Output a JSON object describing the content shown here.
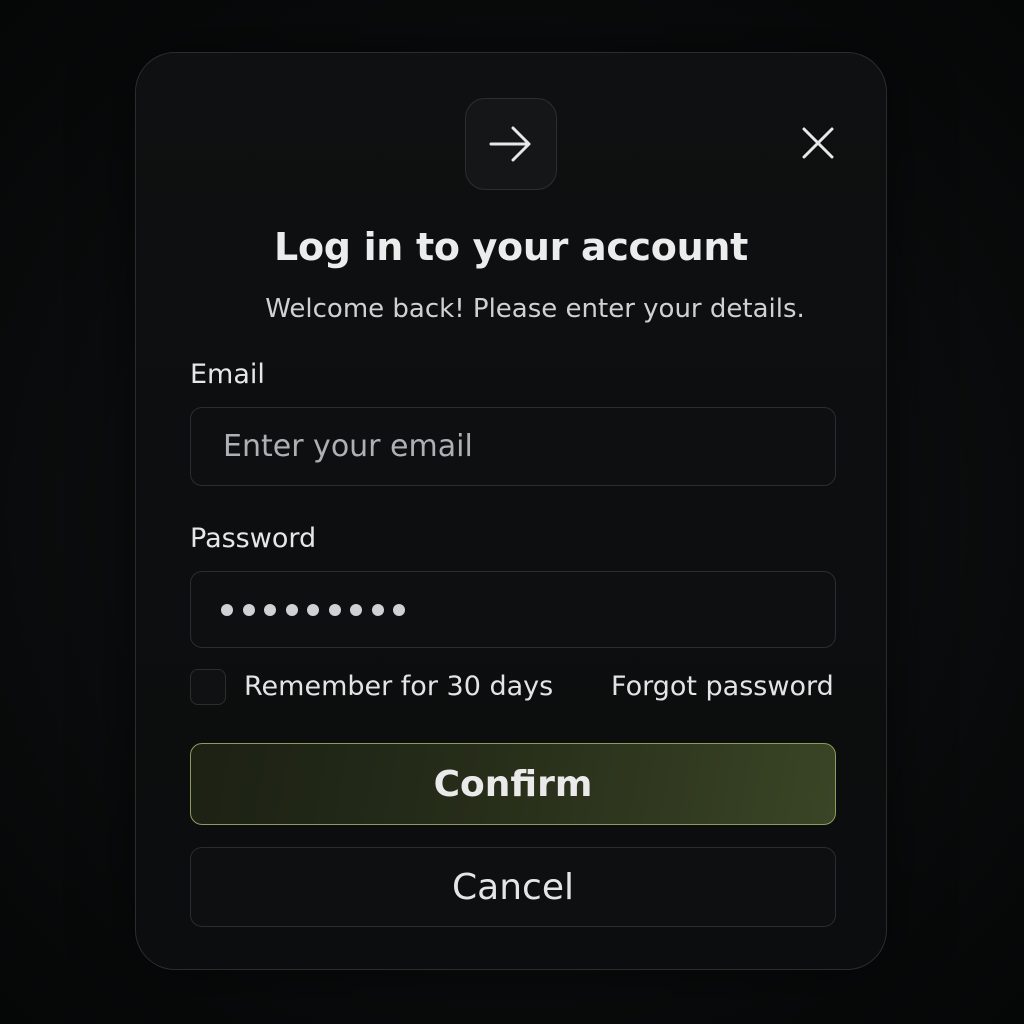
{
  "dialog": {
    "title": "Log in to your account",
    "subtitle": "Welcome back! Please enter your details.",
    "header_icon": "arrow-right-icon",
    "close_icon": "close-icon"
  },
  "form": {
    "email": {
      "label": "Email",
      "placeholder": "Enter your email",
      "value": ""
    },
    "password": {
      "label": "Password",
      "masked_length": 9
    },
    "remember": {
      "label": "Remember for 30 days",
      "checked": false
    },
    "forgot_label": "Forgot password"
  },
  "actions": {
    "confirm_label": "Confirm",
    "cancel_label": "Cancel"
  },
  "colors": {
    "background": "#0b0d0e",
    "accent_border": "#8f9a5e",
    "accent_fill": "#262d19"
  }
}
